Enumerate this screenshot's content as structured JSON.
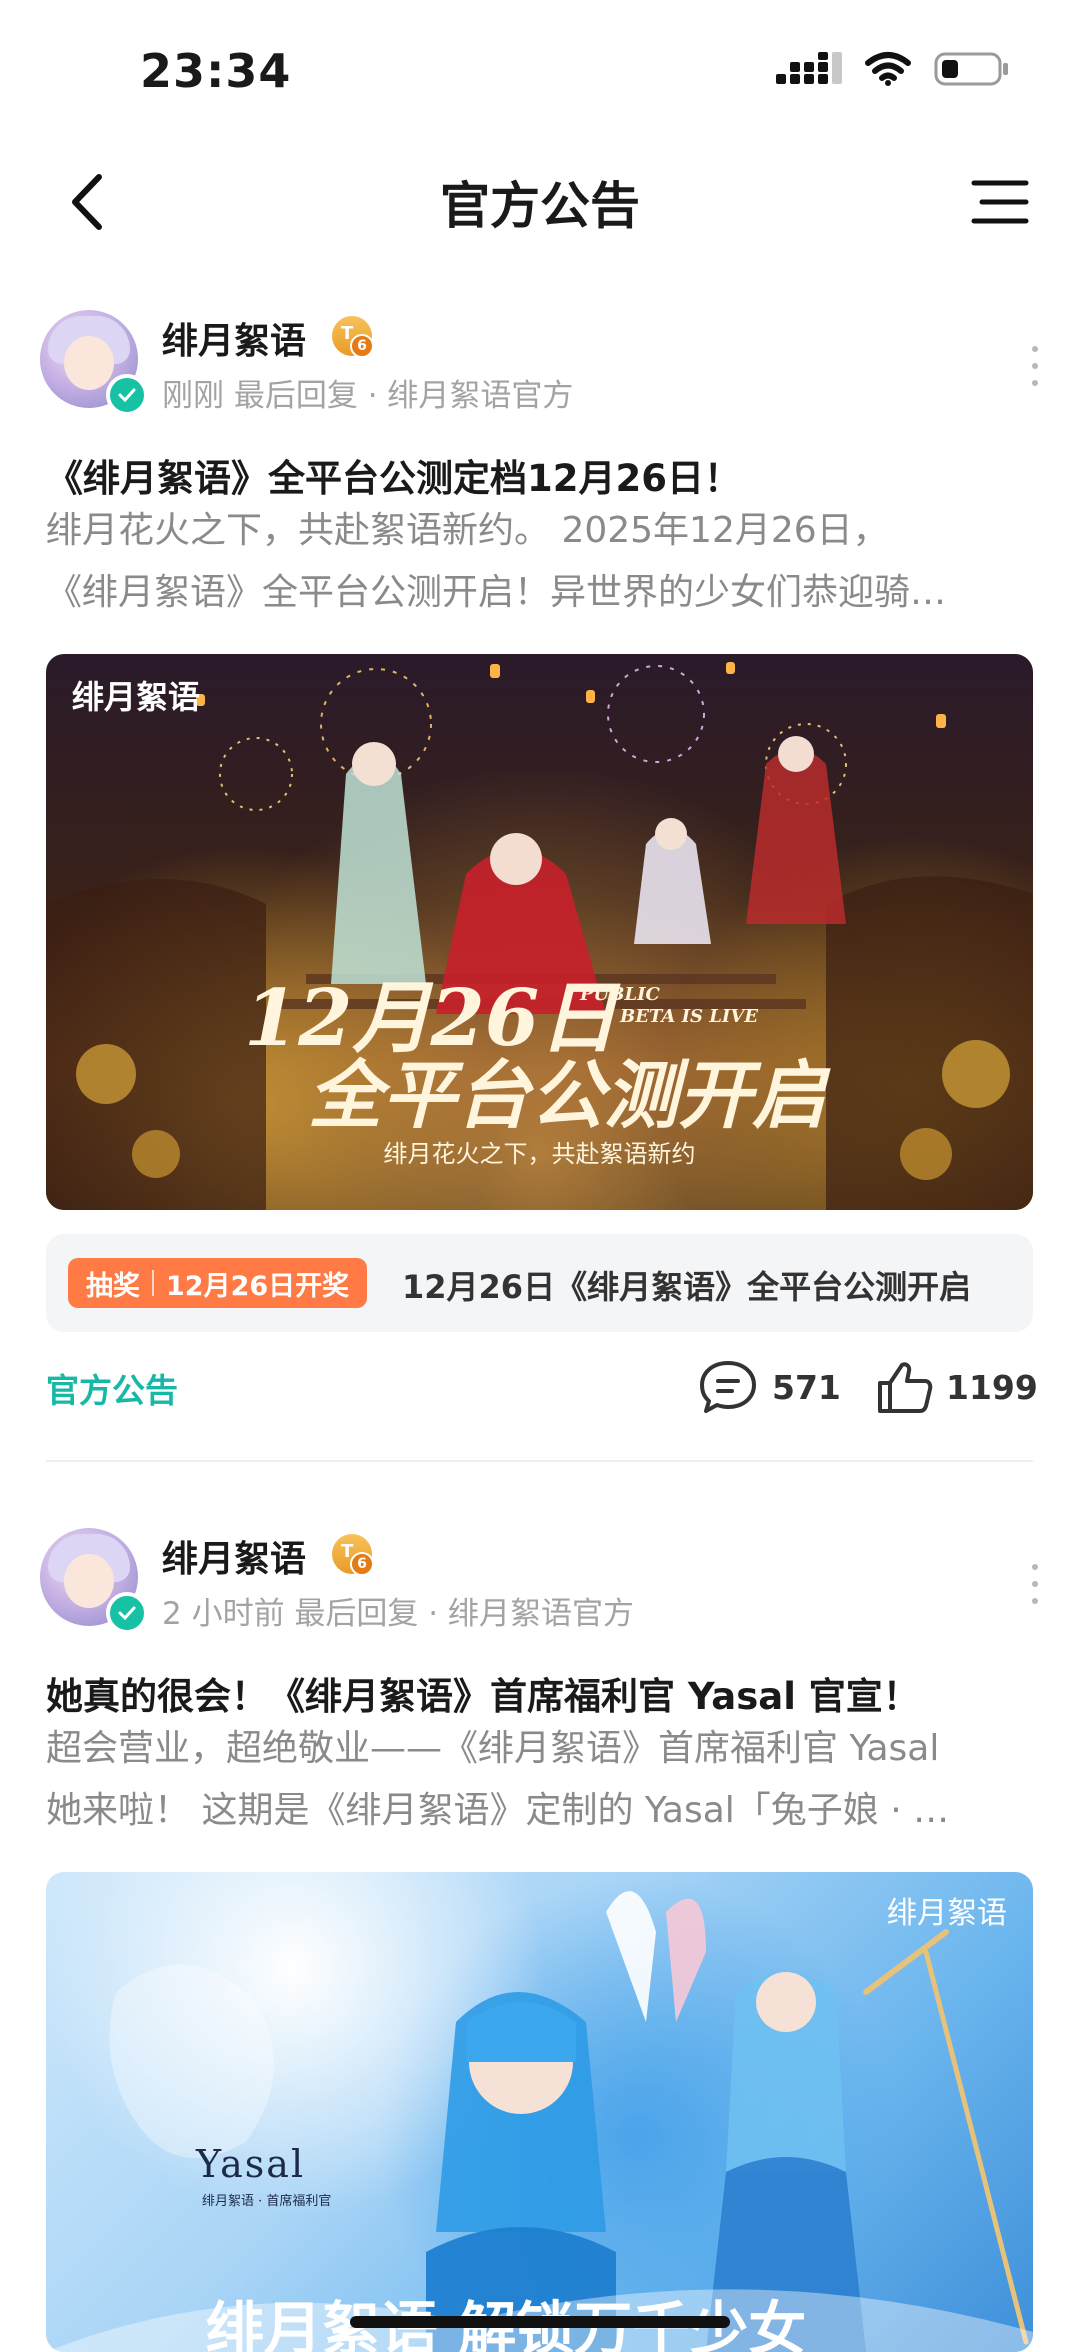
{
  "status_bar": {
    "time": "23:34"
  },
  "nav": {
    "title": "官方公告"
  },
  "posts": [
    {
      "author": "绯月絮语",
      "level": "6",
      "meta": "刚刚 最后回复 · 绯月絮语官方",
      "title": "《绯月絮语》全平台公测定档12月26日！",
      "excerpt_line1": "绯月花火之下，共赴絮语新约。  2025年12月26日，",
      "excerpt_line2": "《绯月絮语》全平台公测开启！异世界的少女们恭迎骑…",
      "image": {
        "logo": "绯月絮语",
        "headline_date": "12月26日",
        "headline_en1": "PUBLIC",
        "headline_en2": "BETA IS LIVE",
        "headline_main": "全平台公测开启",
        "tagline": "绯月花火之下，共赴絮语新约"
      },
      "lottery": {
        "tag_label": "抽奖",
        "tag_date": "12月26日开奖",
        "text": "12月26日《绯月絮语》全平台公测开启"
      },
      "topic": "官方公告",
      "comments": "571",
      "likes": "1199"
    },
    {
      "author": "绯月絮语",
      "level": "6",
      "meta": "2 小时前 最后回复 · 绯月絮语官方",
      "title": "她真的很会！《绯月絮语》首席福利官 Yasal 官宣！",
      "excerpt_line1": "超会营业，超绝敬业——《绯月絮语》首席福利官 Yasal",
      "excerpt_line2": "她来啦！  这期是《绯月絮语》定制的 Yasal「兔子娘 · …",
      "image": {
        "logo": "绯月絮语",
        "name": "Yasal",
        "subtitle": "绯月絮语 · 首席福利官",
        "bottom_text": "绯月絮语 解锁万千少女"
      }
    }
  ],
  "colors": {
    "accent": "#17b8a6",
    "lottery_tag": "#ff7a45",
    "level_badge": "#f0b040"
  }
}
